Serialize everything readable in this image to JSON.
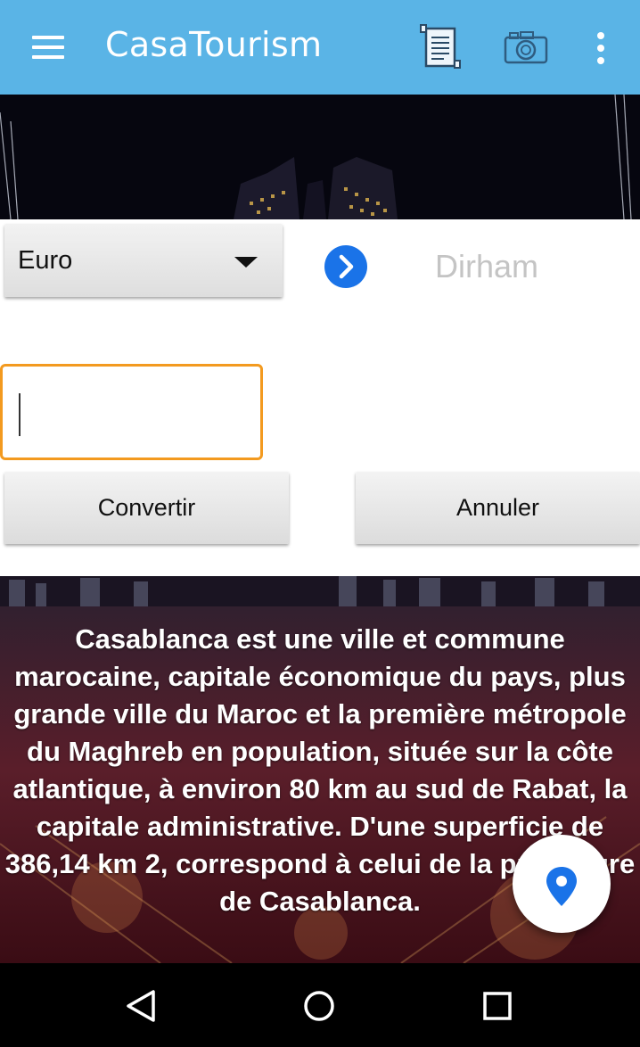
{
  "app_bar": {
    "title": "CasaTourism",
    "icons": [
      "menu-icon",
      "document-icon",
      "camera-icon",
      "more-vert-icon"
    ],
    "background_color": "#5ab4e6"
  },
  "converter": {
    "source_currency": "Euro",
    "target_currency": "Dirham",
    "amount_value": "",
    "convert_label": "Convertir",
    "cancel_label": "Annuler",
    "arrow_icon": "chevron-right-circle-icon",
    "arrow_color": "#1a73e8",
    "focus_color": "#f39a1f"
  },
  "city": {
    "description": "Casablanca est une ville et commune marocaine, capitale économique du pays, plus grande ville du Maroc et la première métropole du Maghreb en population, située sur la côte atlantique, à environ 80 km au sud de Rabat, la capitale administrative. D'une superficie de 386,14 km 2, correspond à celui de la préfecture de Casablanca."
  },
  "fab": {
    "icon": "location-pin-icon",
    "color": "#1a73e8"
  },
  "nav_bar": {
    "icons": [
      "back-icon",
      "home-icon",
      "recents-icon"
    ]
  }
}
